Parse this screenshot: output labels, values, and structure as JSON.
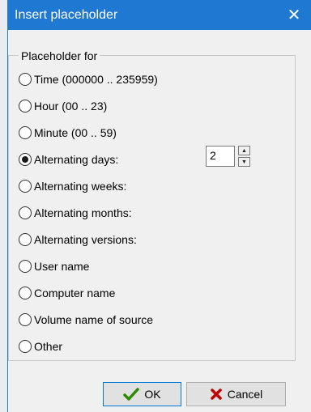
{
  "window": {
    "title": "Insert placeholder",
    "close_glyph": "✕"
  },
  "group": {
    "legend": "Placeholder for",
    "options": [
      {
        "label": "Time (000000 .. 235959)",
        "selected": false
      },
      {
        "label": "Hour (00 .. 23)",
        "selected": false
      },
      {
        "label": "Minute (00 .. 59)",
        "selected": false
      },
      {
        "label": "Alternating days:",
        "selected": true
      },
      {
        "label": "Alternating weeks:",
        "selected": false
      },
      {
        "label": "Alternating months:",
        "selected": false
      },
      {
        "label": "Alternating versions:",
        "selected": false
      },
      {
        "label": "User name",
        "selected": false
      },
      {
        "label": "Computer name",
        "selected": false
      },
      {
        "label": "Volume name of source",
        "selected": false
      },
      {
        "label": "Other",
        "selected": false
      }
    ],
    "spin_value": "2",
    "spin_up_glyph": "▲",
    "spin_down_glyph": "▼"
  },
  "buttons": {
    "ok": {
      "label": "OK",
      "icon": "checkmark-icon",
      "icon_color": "#2e8b00"
    },
    "cancel": {
      "label": "Cancel",
      "icon": "x-icon",
      "icon_color": "#c00000"
    }
  },
  "colors": {
    "titlebar": "#1f78d1",
    "window_bg": "#f0f0f0"
  }
}
